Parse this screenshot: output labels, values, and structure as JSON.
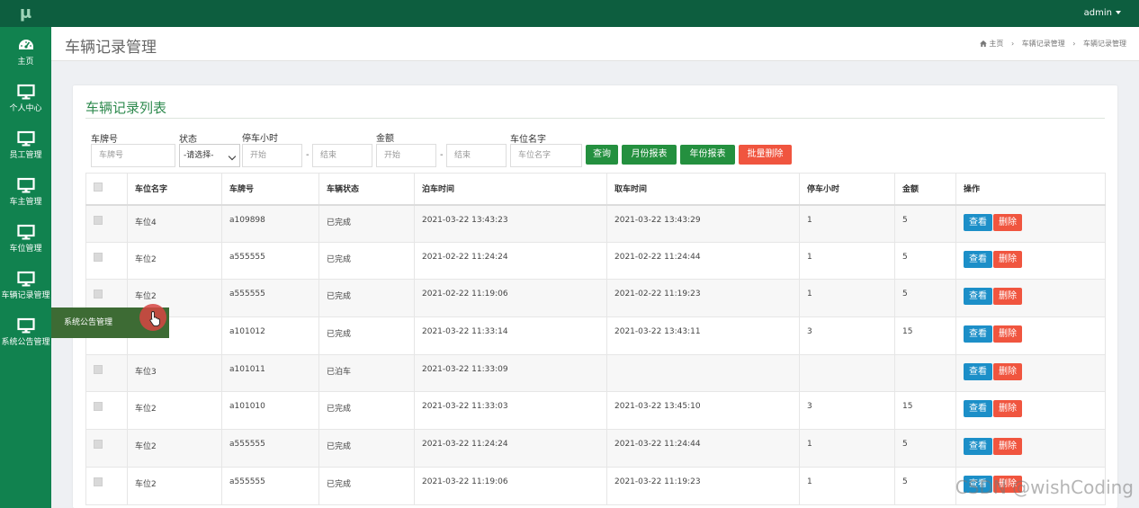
{
  "app": {
    "logo": "μ",
    "user": "admin"
  },
  "sidebar": {
    "items": [
      {
        "label": "主页",
        "icon": "dashboard-icon"
      },
      {
        "label": "个人中心",
        "icon": "monitor-icon"
      },
      {
        "label": "员工管理",
        "icon": "monitor-icon"
      },
      {
        "label": "车主管理",
        "icon": "monitor-icon"
      },
      {
        "label": "车位管理",
        "icon": "monitor-icon"
      },
      {
        "label": "车辆记录管理",
        "icon": "monitor-icon"
      },
      {
        "label": "系统公告管理",
        "icon": "monitor-icon"
      }
    ],
    "flyout": "系统公告管理"
  },
  "header": {
    "title": "车辆记录管理",
    "breadcrumb": [
      "主页",
      "车辆记录管理",
      "车辆记录管理"
    ],
    "separator": "›"
  },
  "panel": {
    "title": "车辆记录列表"
  },
  "filters": {
    "plate_label": "车牌号",
    "plate_placeholder": "车牌号",
    "status_label": "状态",
    "status_value": "-请选择-",
    "hours_label": "停车小时",
    "hours_start_placeholder": "开始",
    "hours_end_placeholder": "结束",
    "amount_label": "金额",
    "amount_start_placeholder": "开始",
    "amount_end_placeholder": "结束",
    "space_label": "车位名字",
    "space_placeholder": "车位名字",
    "dash": "-"
  },
  "buttons": {
    "query": "查询",
    "monthly": "月份报表",
    "yearly": "年份报表",
    "batch_delete": "批量删除"
  },
  "colors": {
    "topbar": "#0d5e3f",
    "sidebar": "#11824f",
    "accent": "#24903f",
    "danger": "#f0553f",
    "info": "#1c8fc8"
  },
  "table": {
    "columns": [
      "车位名字",
      "车牌号",
      "车辆状态",
      "泊车时间",
      "取车时间",
      "停车小时",
      "金额",
      "操作"
    ],
    "view_label": "查看",
    "delete_label": "删除",
    "rows": [
      [
        "车位4",
        "a109898",
        "已完成",
        "2021-03-22 13:43:23",
        "2021-03-22 13:43:29",
        "1",
        "5"
      ],
      [
        "车位2",
        "a555555",
        "已完成",
        "2021-02-22 11:24:24",
        "2021-02-22 11:24:44",
        "1",
        "5"
      ],
      [
        "车位2",
        "a555555",
        "已完成",
        "2021-02-22 11:19:06",
        "2021-02-22 11:19:23",
        "1",
        "5"
      ],
      [
        "",
        "a101012",
        "已完成",
        "2021-03-22 11:33:14",
        "2021-03-22 13:43:11",
        "3",
        "15"
      ],
      [
        "车位3",
        "a101011",
        "已泊车",
        "2021-03-22 11:33:09",
        "",
        "",
        ""
      ],
      [
        "车位2",
        "a101010",
        "已完成",
        "2021-03-22 11:33:03",
        "2021-03-22 13:45:10",
        "3",
        "15"
      ],
      [
        "车位2",
        "a555555",
        "已完成",
        "2021-03-22 11:24:24",
        "2021-03-22 11:24:44",
        "1",
        "5"
      ],
      [
        "车位2",
        "a555555",
        "已完成",
        "2021-03-22 11:19:06",
        "2021-03-22 11:19:23",
        "1",
        "5"
      ]
    ]
  },
  "watermark": "CSDN @wishCoding"
}
